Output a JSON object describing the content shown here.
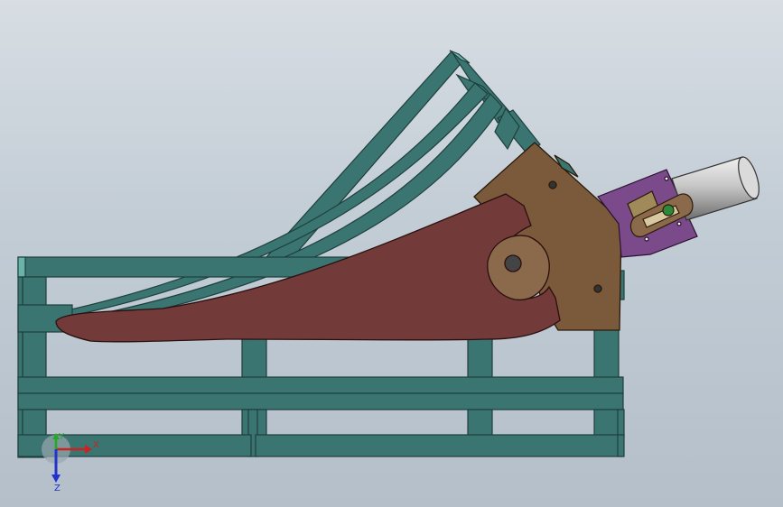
{
  "viewport": {
    "model_name": "",
    "colors": {
      "background_top": "#d7dde3",
      "background_bottom": "#b4bfca",
      "frame": "#3a7571",
      "frame_edge": "#1f3f3c",
      "blade": "#733a3a",
      "plate": "#7a5a3a",
      "bracket": "#7a4a8a",
      "cylinder": "#c8c8c8",
      "link": "#a08a5a"
    }
  },
  "triad": {
    "x_label": "X",
    "y_label": "Y",
    "z_label": "Z",
    "x_color": "#cc2222",
    "y_color": "#22aa22",
    "z_color": "#2233cc"
  }
}
